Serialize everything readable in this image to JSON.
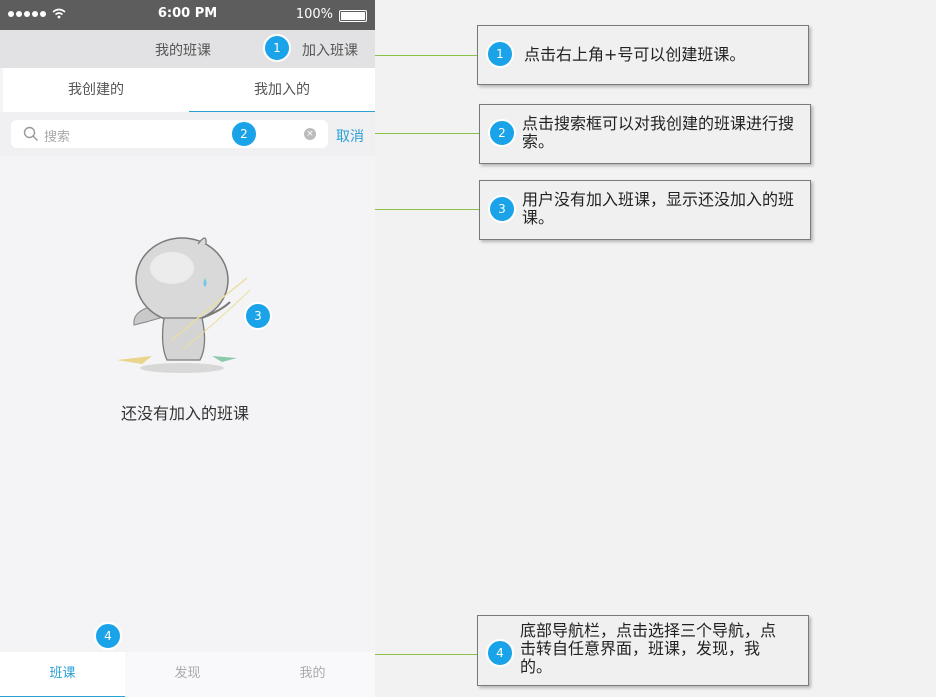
{
  "status_bar": {
    "time": "6:00 PM",
    "battery": "100%"
  },
  "navbar": {
    "title": "我的班课",
    "action": "加入班课"
  },
  "tabs": [
    {
      "label": "我创建的"
    },
    {
      "label": "我加入的"
    }
  ],
  "search": {
    "placeholder": "搜索",
    "cancel": "取消"
  },
  "empty_state": {
    "text": "还没有加入的班课"
  },
  "tabbar": [
    {
      "label": "班课"
    },
    {
      "label": "发现"
    },
    {
      "label": "我的"
    }
  ],
  "badges": {
    "b1": "1",
    "b2": "2",
    "b3": "3",
    "b4": "4"
  },
  "callouts": [
    {
      "number": "1",
      "text": "点击右上角+号可以创建班课。"
    },
    {
      "number": "2",
      "text": "点击搜索框可以对我创建的班课进行搜索。"
    },
    {
      "number": "3",
      "text": "用户没有加入班课，显示还没加入的班课。"
    },
    {
      "number": "4",
      "text": "底部导航栏，点击选择三个导航，点击转自任意界面，班课，发现，我的。"
    }
  ],
  "colors": {
    "accent": "#2a9fd8",
    "badge": "#1aa3e8",
    "connector": "#8bc34a"
  }
}
